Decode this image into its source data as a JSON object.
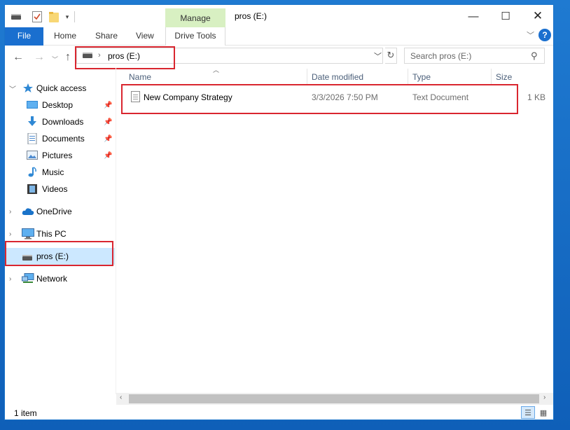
{
  "window": {
    "title": "pros (E:)"
  },
  "quick_access_toolbar": {
    "icons": [
      "drive-icon",
      "properties-icon",
      "new-folder-icon",
      "customize-dropdown-icon"
    ]
  },
  "ribbon": {
    "contextual_group": "Manage",
    "tabs": [
      {
        "label": "File"
      },
      {
        "label": "Home"
      },
      {
        "label": "Share"
      },
      {
        "label": "View"
      },
      {
        "label": "Drive Tools"
      }
    ]
  },
  "address": {
    "breadcrumb": "pros (E:)",
    "search_placeholder": "Search pros (E:)"
  },
  "sidebar": {
    "quick_access": {
      "label": "Quick access",
      "items": [
        {
          "label": "Desktop",
          "icon": "desktop-icon"
        },
        {
          "label": "Downloads",
          "icon": "downloads-icon"
        },
        {
          "label": "Documents",
          "icon": "documents-icon"
        },
        {
          "label": "Pictures",
          "icon": "pictures-icon"
        },
        {
          "label": "Music",
          "icon": "music-icon"
        },
        {
          "label": "Videos",
          "icon": "videos-icon"
        }
      ]
    },
    "onedrive": {
      "label": "OneDrive"
    },
    "this_pc": {
      "label": "This PC"
    },
    "drive": {
      "label": "pros (E:)"
    },
    "network": {
      "label": "Network"
    }
  },
  "columns": {
    "name": "Name",
    "date": "Date modified",
    "type": "Type",
    "size": "Size"
  },
  "files": [
    {
      "name": "New Company Strategy",
      "date": "3/3/2026 7:50 PM",
      "type": "Text Document",
      "size": "1 KB"
    }
  ],
  "status": {
    "item_count": "1 item"
  },
  "colors": {
    "accent": "#1a6fcf",
    "highlight": "#d9262f",
    "selection": "#cce8ff",
    "manage_tab": "#d8f0c2"
  }
}
